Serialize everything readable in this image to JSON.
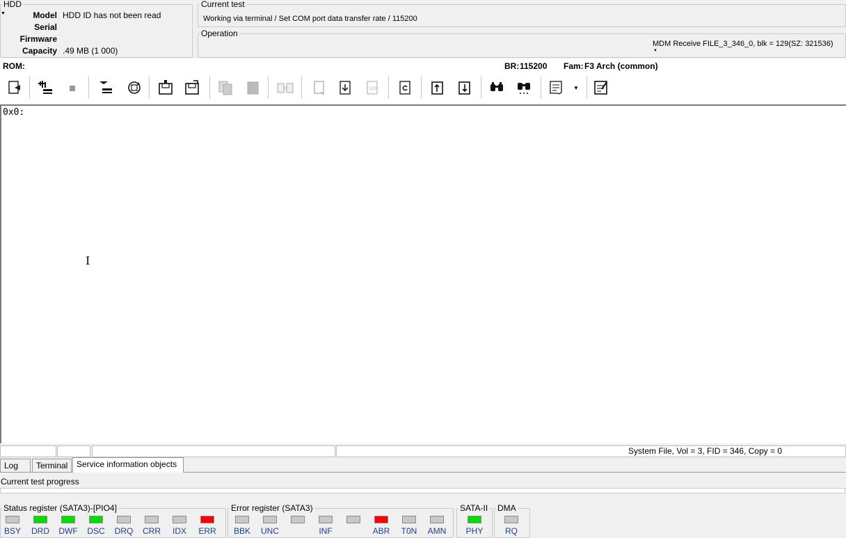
{
  "hdd": {
    "legend": "HDD",
    "model_label": "Model",
    "model_value": "HDD ID has not been read",
    "serial_label": "Serial",
    "serial_value": "",
    "firmware_label": "Firmware",
    "firmware_value": "",
    "capacity_label": "Capacity",
    "capacity_value": ".49 MB (1 000)"
  },
  "current_test": {
    "legend": "Current test",
    "text": "Working via terminal / Set COM port data transfer rate / 115200"
  },
  "operation": {
    "legend": "Operation",
    "text": "MDM Receive FILE_3_346_0, blk = 129(SZ: 321536)"
  },
  "info_bar": {
    "rom_label": "ROM:",
    "br_label": "BR:",
    "br_value": "115200",
    "fam_label": "Fam:",
    "fam_value": "F3 Arch (common)"
  },
  "toolbar": {
    "icons": [
      "open-file-icon",
      "scan-bus-icon",
      "stop-icon",
      "disconnect-icon",
      "reset-icon",
      "save-icon",
      "save-as-icon",
      "copy-icon",
      "paste-icon",
      "compare-icon",
      "new-doc-icon",
      "import-icon",
      "numbers-icon",
      "refresh-doc-icon",
      "upload-icon",
      "download-icon",
      "find-icon",
      "find-next-icon",
      "script-icon",
      "notes-icon"
    ]
  },
  "main": {
    "content": "0x0:"
  },
  "status_bar": {
    "text": "System File, Vol = 3, FID = 346, Copy = 0"
  },
  "tabs": [
    {
      "label": "Log",
      "active": false
    },
    {
      "label": "Terminal",
      "active": false
    },
    {
      "label": "Service information objects",
      "active": true
    }
  ],
  "progress": {
    "label": "Current test progress",
    "value": 0
  },
  "status_register": {
    "legend": "Status register (SATA3)-[PIO4]",
    "flags": [
      {
        "label": "BSY",
        "color": "#c8c8c8"
      },
      {
        "label": "DRD",
        "color": "#00e000"
      },
      {
        "label": "DWF",
        "color": "#00e000"
      },
      {
        "label": "DSC",
        "color": "#00e000"
      },
      {
        "label": "DRQ",
        "color": "#c8c8c8"
      },
      {
        "label": "CRR",
        "color": "#c8c8c8"
      },
      {
        "label": "IDX",
        "color": "#c8c8c8"
      },
      {
        "label": "ERR",
        "color": "#ff0000"
      }
    ]
  },
  "error_register": {
    "legend": "Error register (SATA3)",
    "flags": [
      {
        "label": "BBK",
        "color": "#c8c8c8"
      },
      {
        "label": "UNC",
        "color": "#c8c8c8"
      },
      {
        "label": "",
        "color": "#c8c8c8"
      },
      {
        "label": "INF",
        "color": "#c8c8c8"
      },
      {
        "label": "",
        "color": "#c8c8c8"
      },
      {
        "label": "ABR",
        "color": "#ff0000"
      },
      {
        "label": "T0N",
        "color": "#c8c8c8"
      },
      {
        "label": "AMN",
        "color": "#c8c8c8"
      }
    ]
  },
  "sata": {
    "legend": "SATA-II",
    "flag": {
      "label": "PHY",
      "color": "#00e000"
    }
  },
  "dma": {
    "legend": "DMA",
    "flag": {
      "label": "RQ",
      "color": "#c8c8c8"
    }
  }
}
